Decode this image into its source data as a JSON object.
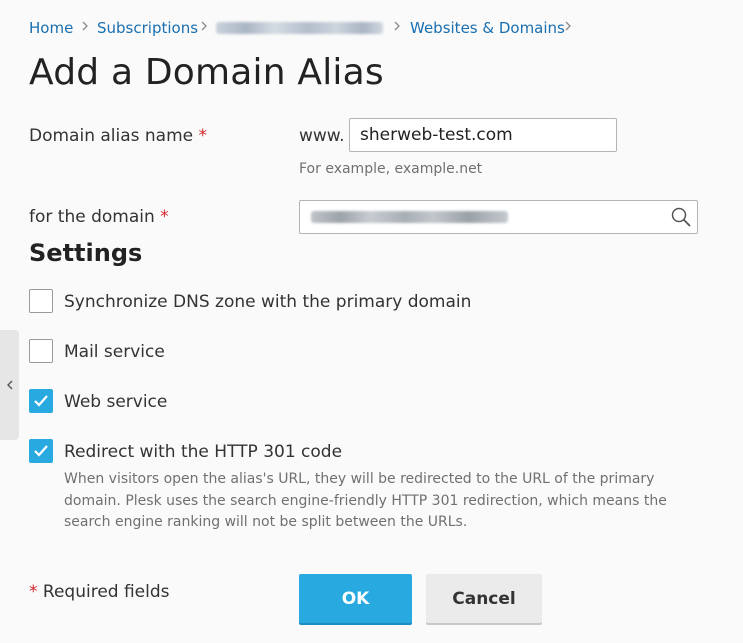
{
  "breadcrumb": {
    "items": [
      "Home",
      "Subscriptions",
      "Websites & Domains"
    ]
  },
  "page": {
    "title": "Add a Domain Alias"
  },
  "form": {
    "alias_name_label": "Domain alias name",
    "required_mark": "*",
    "www_prefix": "www.",
    "alias_value": "sherweb-test.com",
    "alias_hint": "For example, example.net",
    "domain_label": "for the domain",
    "domain_search_icon": "search-icon"
  },
  "settings": {
    "heading": "Settings",
    "options": [
      {
        "label": "Synchronize DNS zone with the primary domain",
        "checked": false
      },
      {
        "label": "Mail service",
        "checked": false
      },
      {
        "label": "Web service",
        "checked": true
      },
      {
        "label": "Redirect with the HTTP 301 code",
        "checked": true
      }
    ],
    "redirect_description": "When visitors open the alias's URL, they will be redirected to the URL of the primary domain. Plesk uses the search engine-friendly HTTP 301 redirection, which means the search engine ranking will not be split between the URLs."
  },
  "footer": {
    "required_note": "Required fields",
    "ok_label": "OK",
    "cancel_label": "Cancel"
  },
  "colors": {
    "accent": "#28a9e0",
    "link": "#1a6fb0",
    "required": "#d4252c"
  },
  "sidebar_toggle_icon": "chevron-left-icon"
}
